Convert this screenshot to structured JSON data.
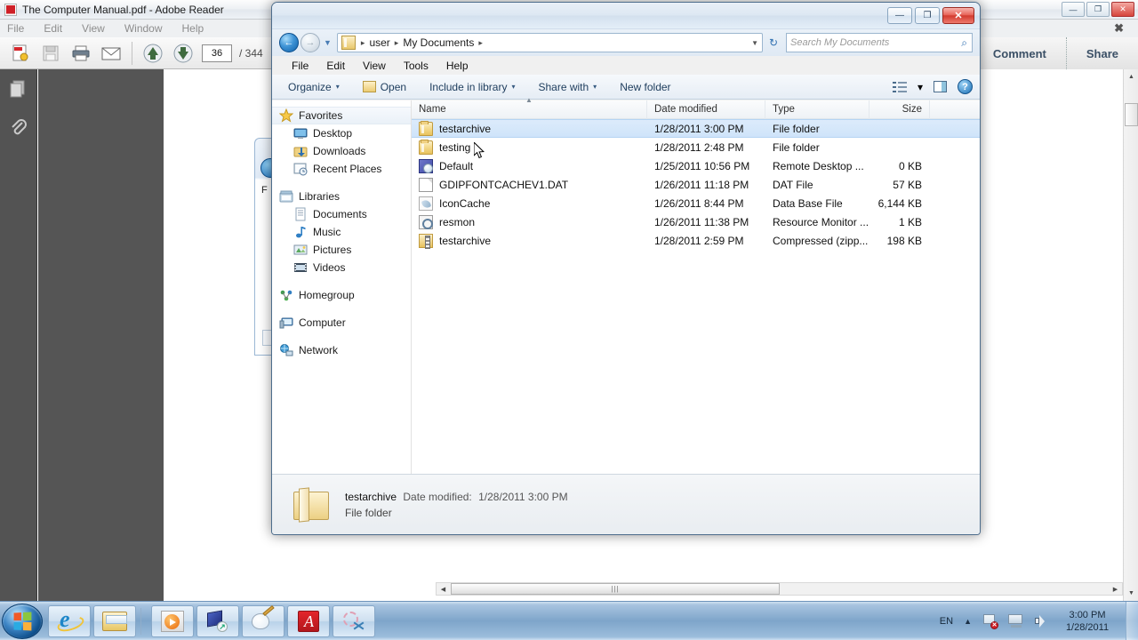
{
  "reader": {
    "title": "The Computer Manual.pdf - Adobe Reader",
    "menus": [
      "File",
      "Edit",
      "View",
      "Window",
      "Help"
    ],
    "close_doc_glyph": "✖",
    "toolbar": {
      "icons": [
        "create-pdf-icon",
        "save-icon",
        "print-icon",
        "email-icon",
        "previous-page-icon",
        "next-page-icon"
      ],
      "page_current": "36",
      "page_total": "/ 344"
    },
    "right_tools": [
      "Comment",
      "Share"
    ],
    "window_buttons": [
      "minimize",
      "maximize",
      "close"
    ],
    "side_panel_icons": [
      "page-thumbnails-icon",
      "attachments-icon"
    ]
  },
  "explorer": {
    "window_buttons": {
      "minimize": "—",
      "maximize": "❐",
      "close": "✕"
    },
    "address": {
      "back_tooltip": "Back",
      "forward_tooltip": "Forward",
      "crumbs": [
        "user",
        "My Documents"
      ],
      "separator": "▸",
      "dropdown": "▼",
      "refresh": "↻"
    },
    "search": {
      "placeholder": "Search My Documents",
      "icon": "search-icon"
    },
    "menus": [
      "File",
      "Edit",
      "View",
      "Tools",
      "Help"
    ],
    "toolbar": {
      "organize": "Organize",
      "open": "Open",
      "include_in_library": "Include in library",
      "share_with": "Share with",
      "new_folder": "New folder",
      "caret": "▾",
      "view_icon": "change-view-icon",
      "pane_icon": "preview-pane-icon",
      "help_icon": "help-icon"
    },
    "nav_pane": [
      {
        "label": "Favorites",
        "icon": "star-icon",
        "level": 0,
        "selected": true
      },
      {
        "label": "Desktop",
        "icon": "desktop-icon",
        "level": 1
      },
      {
        "label": "Downloads",
        "icon": "downloads-icon",
        "level": 1
      },
      {
        "label": "Recent Places",
        "icon": "recent-places-icon",
        "level": 1
      },
      {
        "gap": true
      },
      {
        "label": "Libraries",
        "icon": "libraries-icon",
        "level": 0
      },
      {
        "label": "Documents",
        "icon": "documents-icon",
        "level": 1
      },
      {
        "label": "Music",
        "icon": "music-icon",
        "level": 1
      },
      {
        "label": "Pictures",
        "icon": "pictures-icon",
        "level": 1
      },
      {
        "label": "Videos",
        "icon": "videos-icon",
        "level": 1
      },
      {
        "gap": true
      },
      {
        "label": "Homegroup",
        "icon": "homegroup-icon",
        "level": 0
      },
      {
        "gap": true
      },
      {
        "label": "Computer",
        "icon": "computer-icon",
        "level": 0
      },
      {
        "gap": true
      },
      {
        "label": "Network",
        "icon": "network-icon",
        "level": 0
      }
    ],
    "columns": [
      "Name",
      "Date modified",
      "Type",
      "Size"
    ],
    "sort_indicator": "▲",
    "files": [
      {
        "name": "testarchive",
        "date": "1/28/2011 3:00 PM",
        "type": "File folder",
        "size": "",
        "icon": "folder-icon",
        "selected": true
      },
      {
        "name": "testing",
        "date": "1/28/2011 2:48 PM",
        "type": "File folder",
        "size": "",
        "icon": "folder-icon"
      },
      {
        "name": "Default",
        "date": "1/25/2011 10:56 PM",
        "type": "Remote Desktop ...",
        "size": "0 KB",
        "icon": "rdp-file-icon"
      },
      {
        "name": "GDIPFONTCACHEV1.DAT",
        "date": "1/26/2011 11:18 PM",
        "type": "DAT File",
        "size": "57 KB",
        "icon": "generic-file-icon"
      },
      {
        "name": "IconCache",
        "date": "1/26/2011 8:44 PM",
        "type": "Data Base File",
        "size": "6,144 KB",
        "icon": "database-file-icon"
      },
      {
        "name": "resmon",
        "date": "1/26/2011 11:38 PM",
        "type": "Resource Monitor ...",
        "size": "1 KB",
        "icon": "resmon-icon"
      },
      {
        "name": "testarchive",
        "date": "1/28/2011 2:59 PM",
        "type": "Compressed (zipp...",
        "size": "198 KB",
        "icon": "zip-folder-icon"
      }
    ],
    "details": {
      "name": "testarchive",
      "date_label": "Date modified:",
      "date_value": "1/28/2011 3:00 PM",
      "kind": "File folder",
      "icon": "open-folder-icon"
    }
  },
  "taskbar": {
    "start_label": "start-orb",
    "pinned": [
      {
        "name": "internet-explorer-icon"
      },
      {
        "name": "windows-explorer-icon"
      }
    ],
    "running": [
      {
        "name": "windows-media-player-icon"
      },
      {
        "name": "remote-desktop-icon"
      },
      {
        "name": "paint-icon"
      },
      {
        "name": "adobe-reader-icon"
      },
      {
        "name": "snipping-tool-icon"
      }
    ],
    "tray": {
      "language": "EN",
      "show_hidden": "▲",
      "icons": [
        "action-center-icon",
        "network-icon",
        "volume-icon"
      ],
      "time": "3:00 PM",
      "date": "1/28/2011"
    }
  }
}
